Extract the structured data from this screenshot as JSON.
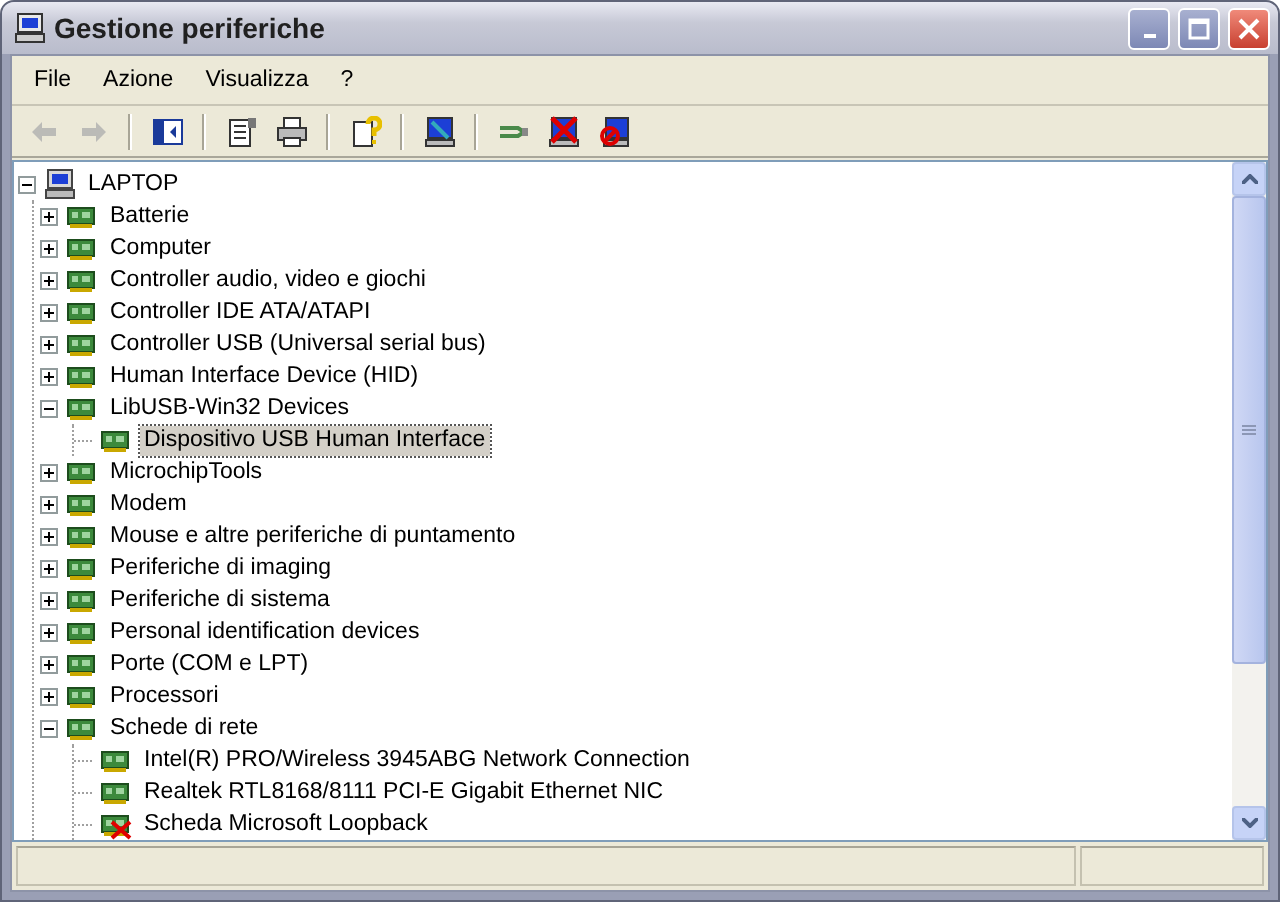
{
  "window": {
    "title": "Gestione periferiche"
  },
  "menu": [
    {
      "label": "File"
    },
    {
      "label": "Azione"
    },
    {
      "label": "Visualizza"
    },
    {
      "label": "?"
    }
  ],
  "toolbar": [
    {
      "kind": "button",
      "disabled": true
    },
    {
      "kind": "button",
      "disabled": true
    },
    {
      "kind": "separator"
    },
    {
      "kind": "button",
      "disabled": false
    },
    {
      "kind": "separator"
    },
    {
      "kind": "button",
      "disabled": false
    },
    {
      "kind": "button",
      "disabled": false
    },
    {
      "kind": "separator"
    },
    {
      "kind": "button",
      "disabled": false
    },
    {
      "kind": "separator"
    },
    {
      "kind": "button",
      "disabled": false
    },
    {
      "kind": "separator"
    },
    {
      "kind": "button",
      "disabled": false
    },
    {
      "kind": "button",
      "disabled": false
    },
    {
      "kind": "button",
      "disabled": false
    }
  ],
  "tree": {
    "label": "LAPTOP",
    "expanded": true,
    "selected": false,
    "children": [
      {
        "label": "Batterie",
        "expanded": false,
        "selected": false
      },
      {
        "label": "Computer",
        "expanded": false,
        "selected": false
      },
      {
        "label": "Controller audio, video e giochi",
        "expanded": false,
        "selected": false
      },
      {
        "label": "Controller IDE ATA/ATAPI",
        "expanded": false,
        "selected": false
      },
      {
        "label": "Controller USB (Universal serial bus)",
        "expanded": false,
        "selected": false
      },
      {
        "label": "Human Interface Device (HID)",
        "expanded": false,
        "selected": false
      },
      {
        "label": "LibUSB-Win32 Devices",
        "expanded": true,
        "selected": false,
        "children": [
          {
            "label": "Dispositivo USB Human Interface",
            "selected": true,
            "disabled": false
          }
        ]
      },
      {
        "label": "MicrochipTools",
        "expanded": false,
        "selected": false
      },
      {
        "label": "Modem",
        "expanded": false,
        "selected": false
      },
      {
        "label": "Mouse e altre periferiche di puntamento",
        "expanded": false,
        "selected": false
      },
      {
        "label": "Periferiche di imaging",
        "expanded": false,
        "selected": false
      },
      {
        "label": "Periferiche di sistema",
        "expanded": false,
        "selected": false
      },
      {
        "label": "Personal identification devices",
        "expanded": false,
        "selected": false
      },
      {
        "label": "Porte (COM e LPT)",
        "expanded": false,
        "selected": false
      },
      {
        "label": "Processori",
        "expanded": false,
        "selected": false
      },
      {
        "label": "Schede di rete",
        "expanded": true,
        "selected": false,
        "children": [
          {
            "label": "Intel(R) PRO/Wireless 3945ABG Network Connection",
            "selected": false,
            "disabled": false
          },
          {
            "label": "Realtek RTL8168/8111 PCI-E Gigabit Ethernet NIC",
            "selected": false,
            "disabled": false
          },
          {
            "label": "Scheda Microsoft Loopback",
            "selected": false,
            "disabled": true
          }
        ]
      }
    ]
  }
}
